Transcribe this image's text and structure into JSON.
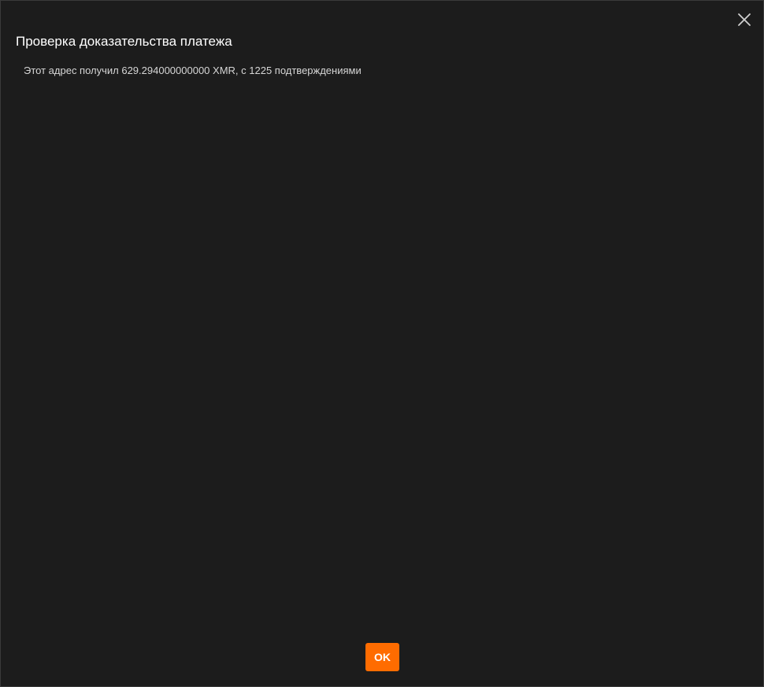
{
  "dialog": {
    "title": "Проверка доказательства платежа",
    "message": "Этот адрес получил 629.294000000000 XMR, с 1225 подтверждениями",
    "ok_label": "OK",
    "close_icon": "close-icon"
  },
  "colors": {
    "background": "#1c1c1c",
    "accent": "#ff6c00",
    "text": "#ffffff",
    "muted_text": "#d6d6d6"
  }
}
